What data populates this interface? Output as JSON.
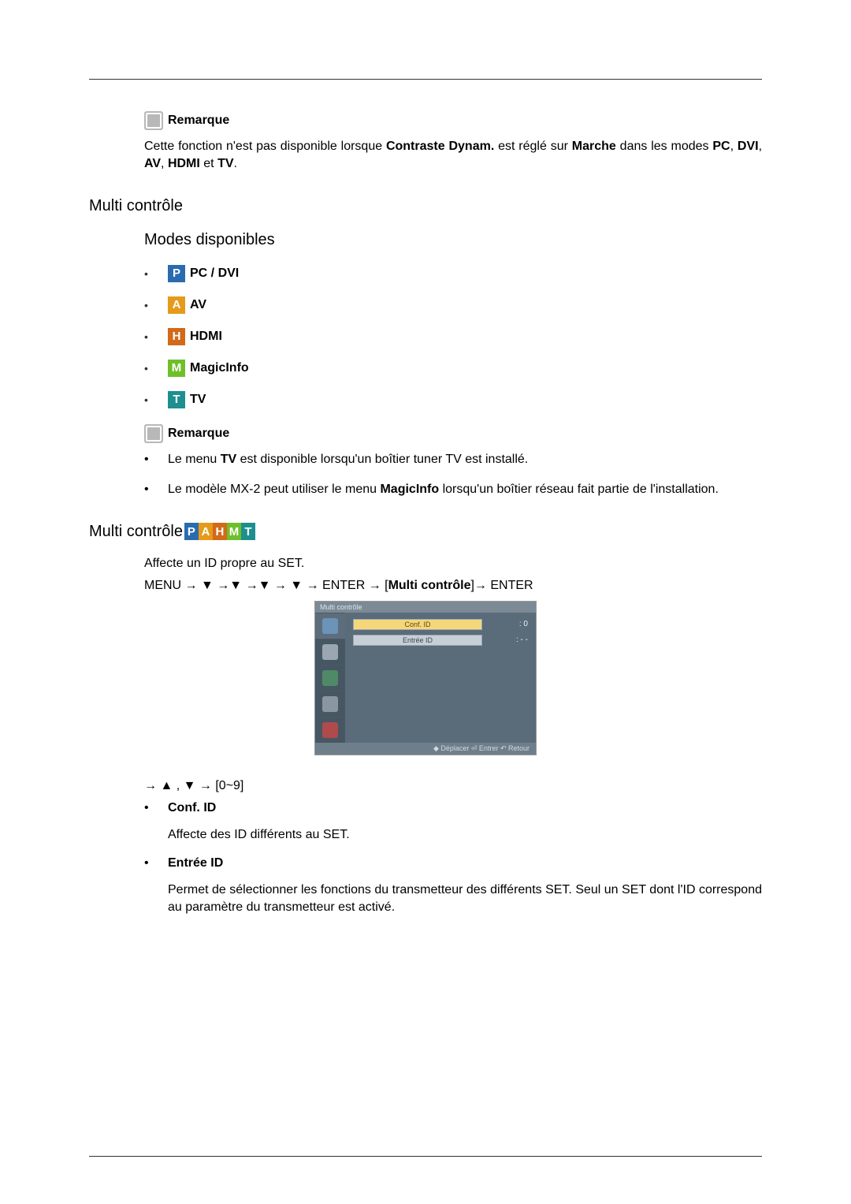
{
  "note_label": "Remarque",
  "note1_html": "Cette fonction n'est pas disponible lorsque <b>Contraste Dynam.</b> est réglé sur <b>Marche</b> dans les modes <b>PC</b>, <b>DVI</b>, <b>AV</b>, <b>HDMI</b> et <b>TV</b>.",
  "h2_multi_control": "Multi contrôle",
  "h3_modes": "Modes disponibles",
  "modes": [
    {
      "letter": "P",
      "cls": "p",
      "label": "PC / DVI"
    },
    {
      "letter": "A",
      "cls": "a",
      "label": "AV"
    },
    {
      "letter": "H",
      "cls": "h",
      "label": "HDMI"
    },
    {
      "letter": "M",
      "cls": "m",
      "label": "MagicInfo"
    },
    {
      "letter": "T",
      "cls": "t",
      "label": "TV"
    }
  ],
  "note_tv_html": "Le menu <b>TV</b> est disponible lorsqu'un boîtier tuner TV est installé.",
  "note_mx2_html": "Le modèle MX-2 peut utiliser le menu <b>MagicInfo</b> lorsqu'un boîtier réseau fait partie de l'installation.",
  "icon_strip": [
    "p",
    "a",
    "h",
    "m",
    "t"
  ],
  "icon_strip_letters": [
    "P",
    "A",
    "H",
    "M",
    "T"
  ],
  "affecte_text": "Affecte un ID propre au SET.",
  "nav_path_html": "MENU → ▼ →▼ →▼ → ▼ → ENTER → [<b>Multi contrôle</b>]→ ENTER",
  "osd": {
    "title": "Multi contrôle",
    "rows": [
      {
        "label": "Conf. ID",
        "value": "0",
        "sep": ":",
        "highlight": true
      },
      {
        "label": "Entrée ID",
        "value": "- -",
        "sep": ":",
        "highlight": false
      }
    ],
    "footer": "◆ Déplacer  ⏎ Entrer   ↶ Retour"
  },
  "arrows_range": "→ ▲ , ▼ → [0~9]",
  "defs": [
    {
      "term": "Conf. ID",
      "desc": "Affecte des ID différents au SET."
    },
    {
      "term": "Entrée ID",
      "desc": "Permet de sélectionner les fonctions du transmetteur des différents SET. Seul un SET dont l'ID correspond au paramètre du transmetteur est activé."
    }
  ]
}
